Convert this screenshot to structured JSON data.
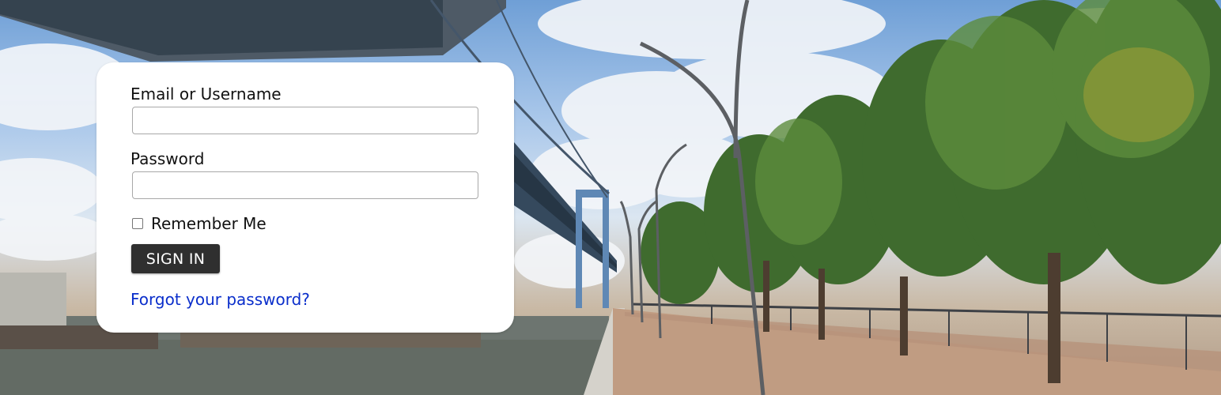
{
  "login": {
    "email_label": "Email or Username",
    "email_value": "",
    "password_label": "Password",
    "password_value": "",
    "remember_label": "Remember Me",
    "remember_checked": false,
    "signin_label": "SIGN IN",
    "forgot_label": "Forgot your password?"
  },
  "colors": {
    "button_bg": "#2f2f2f",
    "link": "#0a2ecb",
    "card_bg": "#ffffff"
  },
  "background": {
    "subject": "bridge-and-riverside-promenade-photo"
  }
}
